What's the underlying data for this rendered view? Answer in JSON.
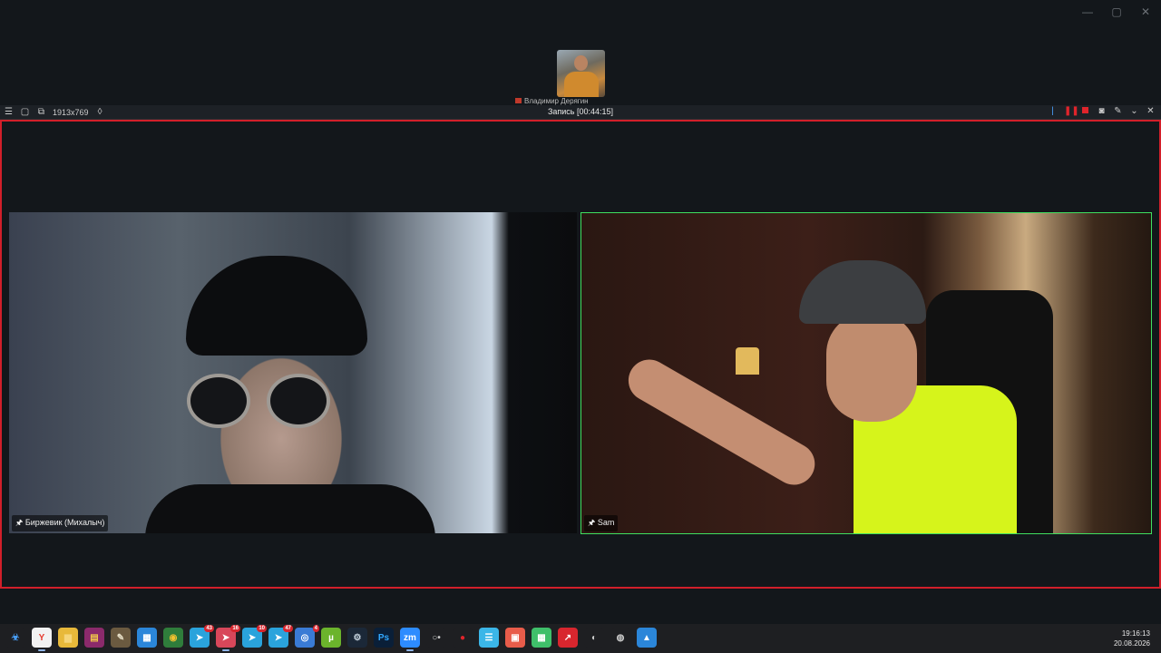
{
  "window_controls": {
    "minimize": "—",
    "maximize": "▢",
    "close": "✕"
  },
  "speaker_thumbnail": {
    "label": "Владимир Дерягин"
  },
  "recorder_toolbar": {
    "resolution": "1913x769",
    "status": "Запись [00:44:15]",
    "colors": {
      "frame": "#d11f2a",
      "stop": "#e0242b"
    }
  },
  "participants": [
    {
      "name": "Биржевик (Михалыч)"
    },
    {
      "name": "Sam",
      "active_speaker_color": "#3fdf5f"
    }
  ],
  "taskbar": {
    "icons": [
      {
        "name": "start-icon",
        "glyph": "☣",
        "bg": "#1e1f22",
        "color": "#4aa3ff"
      },
      {
        "name": "yandex-browser-icon",
        "glyph": "Y",
        "bg": "#f2f2f2",
        "color": "#e63a2e",
        "active": true
      },
      {
        "name": "file-explorer-icon",
        "glyph": "▆",
        "bg": "#e8b93a",
        "color": "#f6d67a"
      },
      {
        "name": "winrar-icon",
        "glyph": "▤",
        "bg": "#8b2a6b",
        "color": "#f0c94a"
      },
      {
        "name": "gimp-icon",
        "glyph": "✎",
        "bg": "#6b5a40",
        "color": "#e8e0c8"
      },
      {
        "name": "store-icon",
        "glyph": "▦",
        "bg": "#2b86d9",
        "color": "#ffffff"
      },
      {
        "name": "chrome-icon",
        "glyph": "◉",
        "bg": "#2f7d3b",
        "color": "#f2c230"
      },
      {
        "name": "telegram-icon-1",
        "glyph": "➤",
        "bg": "#2aa3dc",
        "color": "#ffffff",
        "badge": "43"
      },
      {
        "name": "telegram-icon-2",
        "glyph": "➤",
        "bg": "#d8475a",
        "color": "#ffffff",
        "badge": "16",
        "active": true
      },
      {
        "name": "telegram-icon-3",
        "glyph": "➤",
        "bg": "#2aa3dc",
        "color": "#ffffff",
        "badge": "10"
      },
      {
        "name": "telegram-icon-4",
        "glyph": "➤",
        "bg": "#2aa3dc",
        "color": "#ffffff",
        "badge": "47"
      },
      {
        "name": "chromium-icon",
        "glyph": "◎",
        "bg": "#3a7bd5",
        "color": "#ffffff",
        "badge": "4"
      },
      {
        "name": "utorrent-icon",
        "glyph": "µ",
        "bg": "#6bb42c",
        "color": "#ffffff"
      },
      {
        "name": "steam-icon",
        "glyph": "⚙",
        "bg": "#1b2838",
        "color": "#c7d5e0"
      },
      {
        "name": "photoshop-icon",
        "glyph": "Ps",
        "bg": "#0a1f38",
        "color": "#31a8ff"
      },
      {
        "name": "zoom-icon",
        "glyph": "zm",
        "bg": "#2d8cff",
        "color": "#ffffff",
        "active": true
      },
      {
        "name": "obs-icon",
        "glyph": "○•",
        "bg": "#1e1f22",
        "color": "#cccccc"
      },
      {
        "name": "record-icon",
        "glyph": "●",
        "bg": "#1e1f22",
        "color": "#e0242b"
      },
      {
        "name": "notes-icon",
        "glyph": "☰",
        "bg": "#3bb6e8",
        "color": "#ffffff"
      },
      {
        "name": "wps-icon",
        "glyph": "▣",
        "bg": "#e85c4a",
        "color": "#ffffff"
      },
      {
        "name": "sheets-icon",
        "glyph": "▦",
        "bg": "#3fbf6a",
        "color": "#ffffff"
      },
      {
        "name": "arrow-app-icon",
        "glyph": "↗",
        "bg": "#d8262e",
        "color": "#ffffff"
      },
      {
        "name": "screen-recorder-icon",
        "glyph": "◐",
        "bg": "#1e1f22",
        "color": "#cccccc"
      },
      {
        "name": "obs-studio-icon",
        "glyph": "◍",
        "bg": "#1e1f22",
        "color": "#cccccc"
      },
      {
        "name": "photos-icon",
        "glyph": "▲",
        "bg": "#2b86d9",
        "color": "#ffffff"
      }
    ],
    "time": "19:16:13",
    "date": "20.08.2026"
  }
}
